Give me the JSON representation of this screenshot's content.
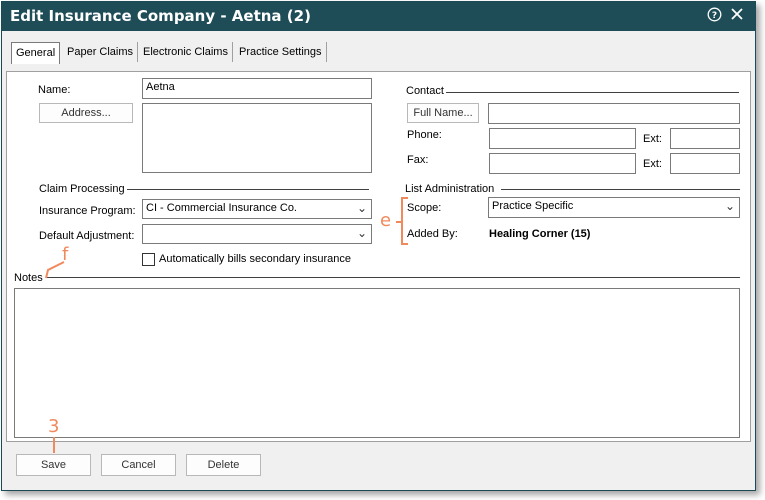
{
  "window": {
    "title": "Edit Insurance Company - Aetna (2)",
    "help_icon": "help-circle-icon",
    "close_icon": "close-icon"
  },
  "tabs": [
    {
      "label": "General",
      "active": true
    },
    {
      "label": "Paper Claims",
      "active": false
    },
    {
      "label": "Electronic Claims",
      "active": false
    },
    {
      "label": "Practice Settings",
      "active": false
    }
  ],
  "general": {
    "name_label": "Name:",
    "name_value": "Aetna",
    "address_button": "Address...",
    "address_value": "",
    "contact_header": "Contact",
    "full_name_button": "Full Name...",
    "full_name_value": "",
    "phone_label": "Phone:",
    "phone_value": "",
    "fax_label": "Fax:",
    "fax_value": "",
    "ext_label": "Ext:",
    "phone_ext_value": "",
    "fax_ext_value": "",
    "claim_processing_header": "Claim Processing",
    "insurance_program_label": "Insurance Program:",
    "insurance_program_value": "CI - Commercial Insurance Co.",
    "default_adjustment_label": "Default Adjustment:",
    "default_adjustment_value": "",
    "auto_bill_label": "Automatically bills secondary insurance",
    "auto_bill_checked": false,
    "list_admin_header": "List Administration",
    "scope_label": "Scope:",
    "scope_value": "Practice Specific",
    "added_by_label": "Added By:",
    "added_by_value": "Healing Corner (15)",
    "notes_label": "Notes",
    "notes_value": ""
  },
  "footer": {
    "save": "Save",
    "cancel": "Cancel",
    "delete": "Delete"
  },
  "annotations": {
    "e": "e",
    "f": "f",
    "three": "3",
    "color": "#f08a5d"
  }
}
